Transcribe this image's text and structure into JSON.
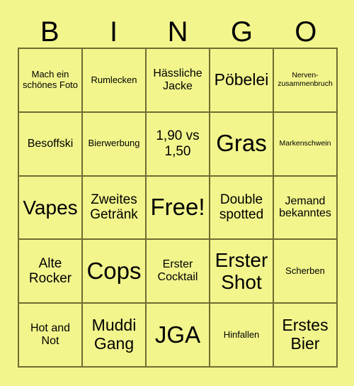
{
  "card": {
    "header_letters": [
      "B",
      "I",
      "N",
      "G",
      "O"
    ],
    "colors": {
      "background": "#f2f58c",
      "cell_fill": "#f2f58c",
      "grid_line": "#6d6d32",
      "text": "#000000"
    },
    "grid": {
      "rows": 5,
      "columns": 5,
      "cells": [
        {
          "text": "Mach ein schönes Foto",
          "size": "s"
        },
        {
          "text": "Rumlecken",
          "size": "s"
        },
        {
          "text": "Hässliche Jacke",
          "size": "m"
        },
        {
          "text": "Pöbelei",
          "size": "xl"
        },
        {
          "text": "Nerven-zusammenbruch",
          "size": "xs"
        },
        {
          "text": "Besoffski",
          "size": "m"
        },
        {
          "text": "Bierwerbung",
          "size": "s"
        },
        {
          "text": "1,90 vs 1,50",
          "size": "l"
        },
        {
          "text": "Gras",
          "size": "huge"
        },
        {
          "text": "Markenschwein",
          "size": "xs"
        },
        {
          "text": "Vapes",
          "size": "xxl"
        },
        {
          "text": "Zweites Getränk",
          "size": "l"
        },
        {
          "text": "Free!",
          "size": "huge"
        },
        {
          "text": "Double spotted",
          "size": "l"
        },
        {
          "text": "Jemand bekanntes",
          "size": "m"
        },
        {
          "text": "Alte Rocker",
          "size": "l"
        },
        {
          "text": "Cops",
          "size": "huge"
        },
        {
          "text": "Erster Cocktail",
          "size": "m"
        },
        {
          "text": "Erster Shot",
          "size": "xxl"
        },
        {
          "text": "Scherben",
          "size": "s"
        },
        {
          "text": "Hot and Not",
          "size": "m"
        },
        {
          "text": "Muddi Gang",
          "size": "xl"
        },
        {
          "text": "JGA",
          "size": "huge"
        },
        {
          "text": "Hinfallen",
          "size": "s"
        },
        {
          "text": "Erstes Bier",
          "size": "xl"
        }
      ]
    }
  }
}
